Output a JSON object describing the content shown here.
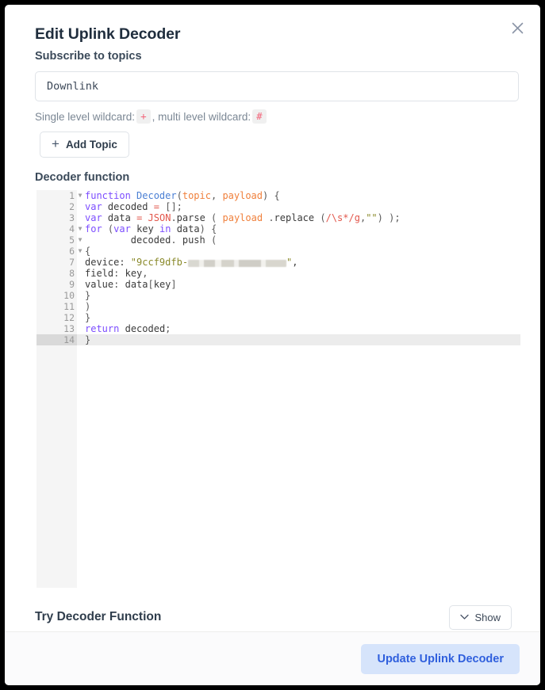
{
  "dialog": {
    "title": "Edit Uplink Decoder",
    "close_icon": "close-icon"
  },
  "topics": {
    "section_label": "Subscribe to topics",
    "input_value": "Downlink",
    "input_placeholder": "Topic",
    "hint_prefix": "Single level wildcard:",
    "hint_single_wildcard": "+",
    "hint_middle": ", multi level wildcard:",
    "hint_multi_wildcard": "#",
    "add_topic_label": "Add Topic",
    "add_topic_icon": "plus-icon"
  },
  "decoder": {
    "section_label": "Decoder function",
    "active_line": 14,
    "lines": [
      {
        "n": "1",
        "fold": true,
        "text": "function Decoder(topic, payload) {"
      },
      {
        "n": "2",
        "fold": false,
        "text": "var decoded = [];"
      },
      {
        "n": "3",
        "fold": false,
        "text": "var data = JSON.parse ( payload .replace (/\\s*/g,\"\") );"
      },
      {
        "n": "4",
        "fold": true,
        "text": "for (var key in data) {"
      },
      {
        "n": "5",
        "fold": true,
        "text": "        decoded. push ("
      },
      {
        "n": "6",
        "fold": true,
        "text": "{"
      },
      {
        "n": "7",
        "fold": false,
        "text": "device: \"9ccf9dfb-[redacted]\","
      },
      {
        "n": "8",
        "fold": false,
        "text": "field: key,"
      },
      {
        "n": "9",
        "fold": false,
        "text": "value: data[key]"
      },
      {
        "n": "10",
        "fold": false,
        "text": "}"
      },
      {
        "n": "11",
        "fold": false,
        "text": ")"
      },
      {
        "n": "12",
        "fold": false,
        "text": "}"
      },
      {
        "n": "13",
        "fold": false,
        "text": "return decoded;"
      },
      {
        "n": "14",
        "fold": false,
        "text": "}"
      }
    ]
  },
  "try_decoder": {
    "label": "Try Decoder Function",
    "show_label": "Show",
    "show_icon": "chevron-down-icon"
  },
  "footer": {
    "primary_label": "Update Uplink Decoder"
  },
  "colors": {
    "primary_button_bg": "#d6e4fb",
    "primary_button_text": "#2f5fdd",
    "wildcard_badge_text": "#f2647a",
    "gutter_bg": "#f5f5f5",
    "active_line_bg": "#ececec"
  }
}
